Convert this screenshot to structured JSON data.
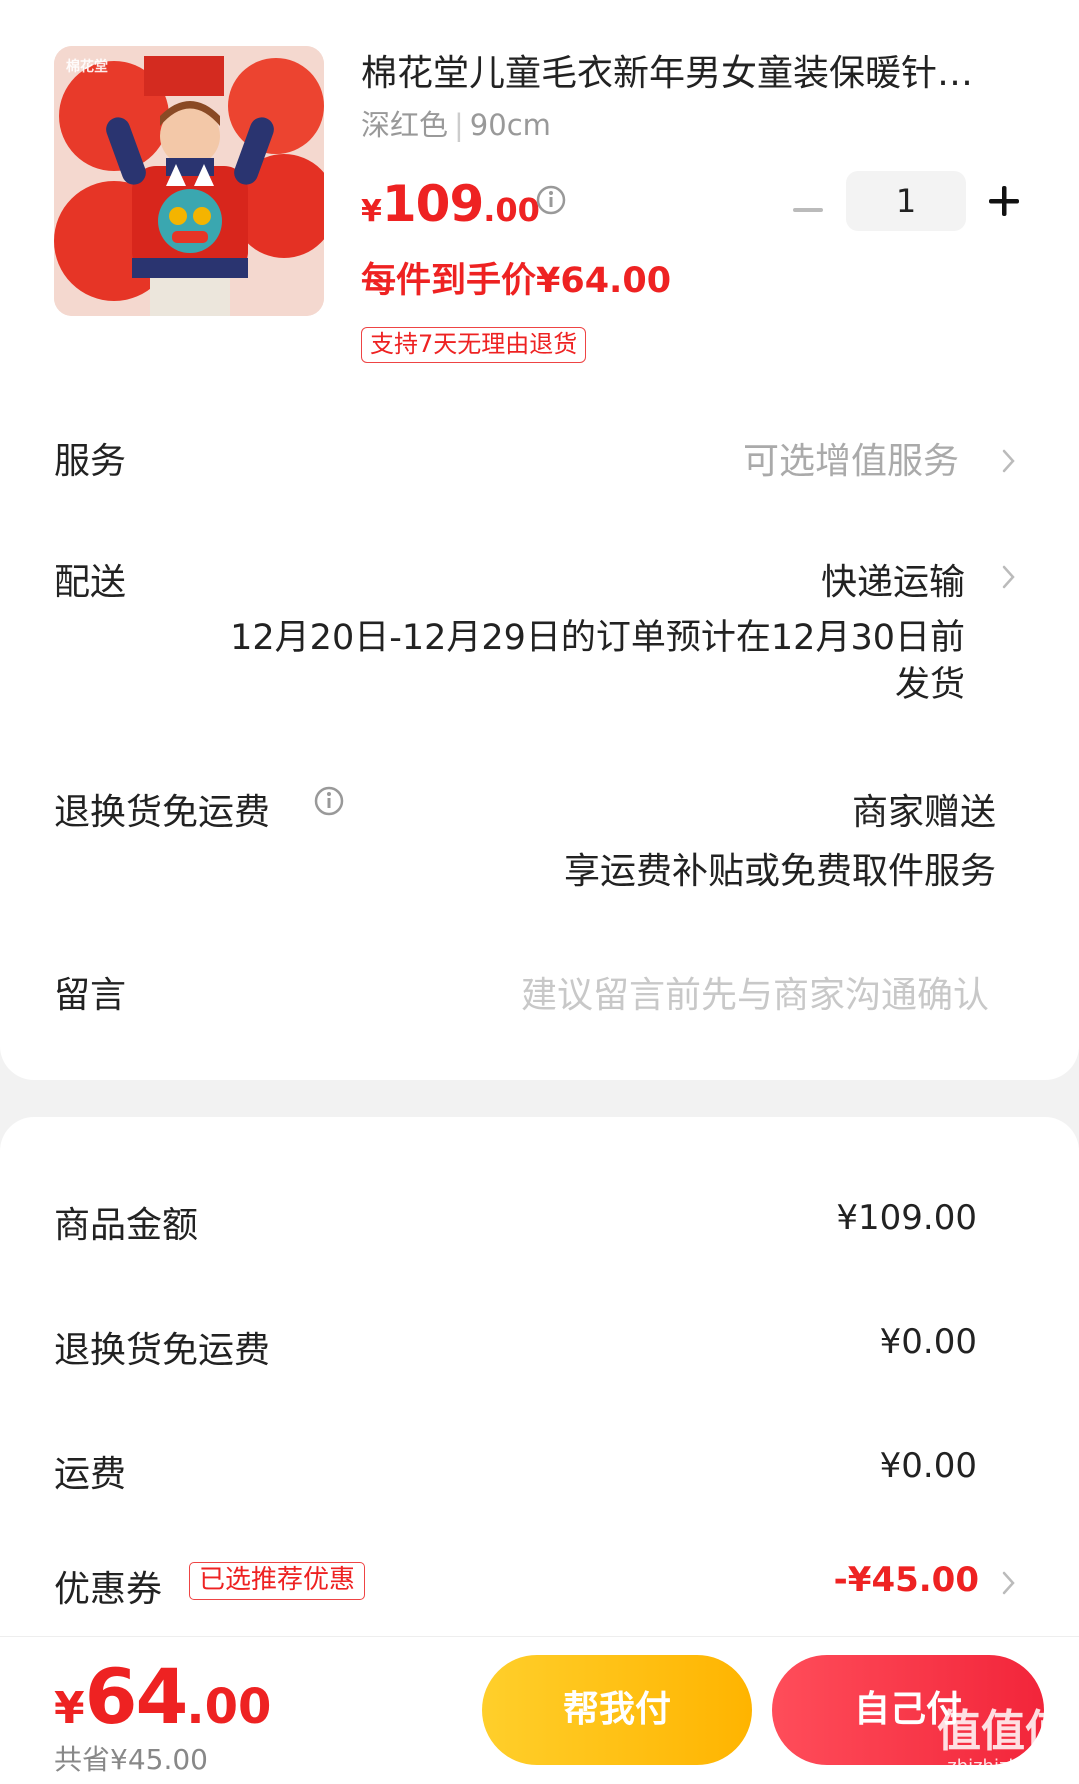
{
  "product": {
    "brand_mark": "棉花堂",
    "title": "棉花堂儿童毛衣新年男女童装保暖针…",
    "color": "深红色",
    "separator": "|",
    "size": "90cm",
    "price_currency": "¥",
    "price_int": "109",
    "price_dec": ".00",
    "quantity": "1",
    "unit_price": "每件到手价¥64.00",
    "return_badge": "支持7天无理由退货"
  },
  "rows": {
    "service_label": "服务",
    "service_value": "可选增值服务",
    "delivery_label": "配送",
    "delivery_value": "快递运输",
    "delivery_note_line1": "12月20日-12月29日的订单预计在12月30日前",
    "delivery_note_line2": "发货",
    "return_free_label": "退换货免运费",
    "return_free_value": "商家赠送",
    "return_free_note": "享运费补贴或免费取件服务",
    "message_label": "留言",
    "message_placeholder": "建议留言前先与商家沟通确认"
  },
  "summary": {
    "goods_label": "商品金额",
    "goods_value": "¥109.00",
    "return_free_label": "退换货免运费",
    "return_free_value": "¥0.00",
    "shipping_label": "运费",
    "shipping_value": "¥0.00",
    "coupon_label": "优惠券",
    "coupon_tag": "已选推荐优惠",
    "coupon_value": "-¥45.00"
  },
  "bottom": {
    "total_currency": "¥",
    "total_int": "64",
    "total_dec": ".00",
    "saved": "共省¥45.00",
    "help_pay": "帮我付",
    "self_pay": "自己付",
    "watermark": "值值值",
    "watermark_url": "zhizhizhi.com"
  },
  "colors": {
    "accent_red": "#ee2222",
    "help_button": "#ffc21a",
    "self_button": "#f2253a"
  }
}
